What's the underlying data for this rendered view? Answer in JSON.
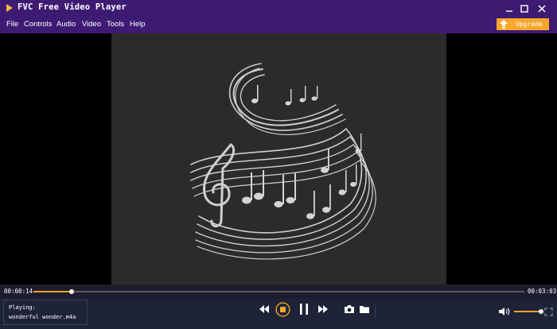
{
  "window": {
    "title": "FVC Free Video Player",
    "minimize_icon": "minimize-icon",
    "maximize_icon": "maximize-icon",
    "close_icon": "close-icon"
  },
  "menu": {
    "items": [
      "File",
      "Controls",
      "Audio",
      "Video",
      "Tools",
      "Help"
    ],
    "upgrade_label": "Upgrade"
  },
  "playback": {
    "current_time": "00:00:14",
    "total_time": "00:03:03",
    "progress": 0.077,
    "state": "playing",
    "volume": 0.95
  },
  "now_playing": {
    "label": "Playing:",
    "filename": "wonderful wonder.m4a"
  },
  "icons": {
    "rewind": "rewind-icon",
    "stop": "stop-icon",
    "pause": "pause-icon",
    "forward": "fast-forward-icon",
    "snapshot": "camera-icon",
    "open_folder": "folder-icon",
    "volume": "volume-icon",
    "fullscreen": "fullscreen-icon"
  },
  "colors": {
    "titlebar": "#3d1b73",
    "accent": "#f6a623",
    "control_bg": "#1e2338",
    "video_bg": "#2b2b2b"
  }
}
